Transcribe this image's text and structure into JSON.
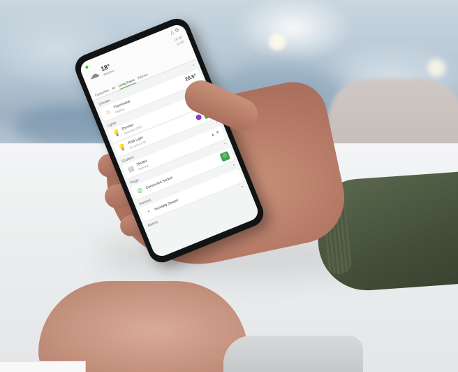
{
  "phone_app": {
    "header": {
      "weather_icon": "cloud-sun-icon",
      "temperature": "18°",
      "weather_label": "Weather",
      "time_1": "07:00",
      "time_2": "21:30"
    },
    "tabs": [
      {
        "label": "Favourites"
      },
      {
        "label": "All"
      },
      {
        "label": "Living Room",
        "active": true
      },
      {
        "label": "Kitchen"
      }
    ],
    "sections": {
      "climate": {
        "title": "Climate",
        "items": [
          {
            "name": "Thermostat",
            "sub": "Heating",
            "value": "20.5°",
            "icon": "flame-icon"
          }
        ]
      },
      "lights": {
        "title": "Lights",
        "items": [
          {
            "name": "Dimmer",
            "sub": "Switched 100%",
            "icon": "bulb-icon"
          },
          {
            "name": "RGB Light",
            "sub": "On until 22:00",
            "icon": "bulb-icon"
          }
        ]
      },
      "shutters": {
        "title": "Shutters",
        "items": [
          {
            "name": "Shutter",
            "sub": "Opening",
            "icon": "shutter-icon"
          }
        ]
      },
      "plugs": {
        "title": "Plugs",
        "items": [
          {
            "name": "Connected Socket",
            "icon": "socket-icon"
          }
        ]
      },
      "sensors": {
        "title": "Sensors",
        "items": [
          {
            "name": "Humidity Sensor",
            "icon": "sensor-icon"
          }
        ]
      },
      "alarms": {
        "title": "Alarms"
      }
    },
    "colors": {
      "accent_green": "#3fa64a",
      "rgb_dot": "#8a3fc7",
      "flame": "#e8912b",
      "bulb": "#f0b400"
    }
  }
}
